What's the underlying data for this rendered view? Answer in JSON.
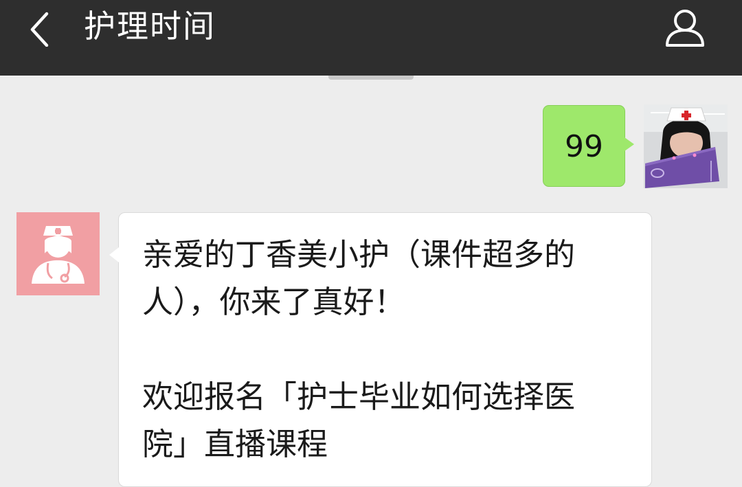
{
  "header": {
    "title": "护理时间",
    "back_icon": "chevron-left-icon",
    "profile_icon": "person-icon"
  },
  "messages": [
    {
      "direction": "outgoing",
      "text": "99",
      "avatar": "nurse-selfie-avatar",
      "bubble_color": "#9ee86b"
    },
    {
      "direction": "incoming",
      "avatar": "nurse-logo-avatar",
      "avatar_color": "#f19fa3",
      "paragraphs": [
        "亲爱的丁香美小护（课件超多的人），你来了真好！",
        "欢迎报名「护士毕业如何选择医院」直播课程"
      ]
    }
  ],
  "colors": {
    "header_bg": "#2e2e2e",
    "chat_bg": "#ededed",
    "incoming_bubble": "#ffffff"
  }
}
